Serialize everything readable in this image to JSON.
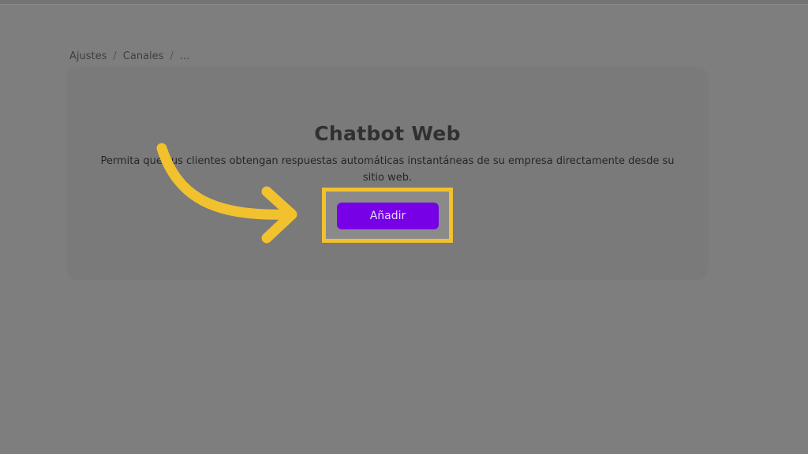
{
  "breadcrumb": {
    "items": [
      "Ajustes",
      "Canales",
      "..."
    ],
    "separator": "/"
  },
  "card": {
    "title": "Chatbot Web",
    "description": "Permita que sus clientes obtengan respuestas automáticas instantáneas de su empresa directamente desde su sitio web.",
    "add_label": "Añadir"
  },
  "colors": {
    "accent_button": "#7700e6",
    "highlight": "#f2c12e",
    "overlay": "#7e7e7e"
  },
  "icons": {
    "annotation": "curved-arrow-icon"
  }
}
